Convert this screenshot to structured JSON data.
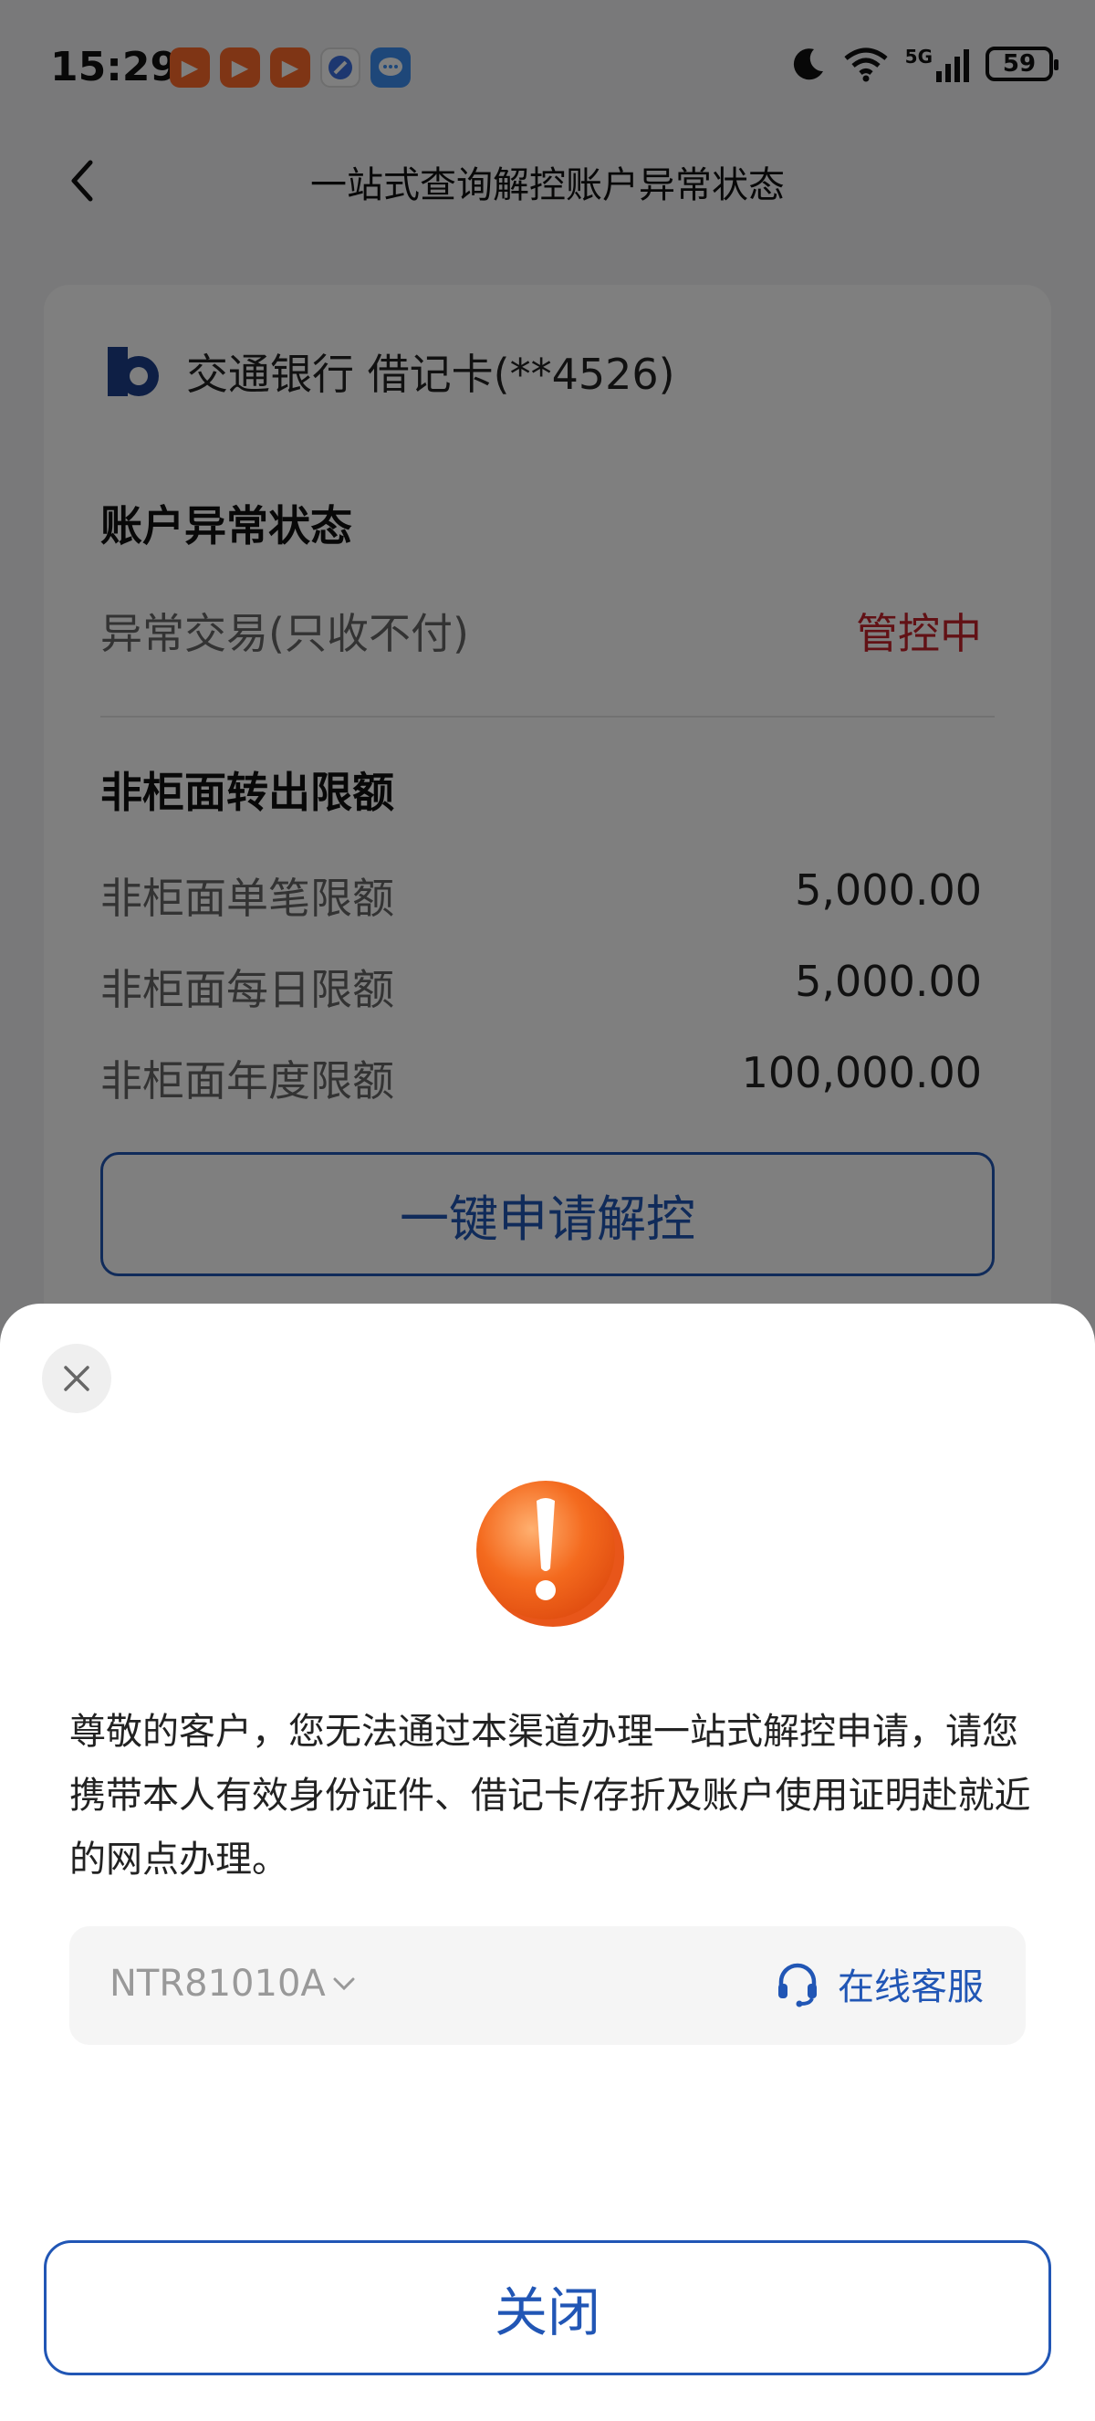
{
  "status_bar": {
    "time": "15:29",
    "battery": "59",
    "network": "5G"
  },
  "header": {
    "title": "一站式查询解控账户异常状态"
  },
  "account": {
    "bank_name": "交通银行 借记卡(**4526)",
    "abnormal_section_title": "账户异常状态",
    "abnormal_label": "异常交易(只收不付)",
    "abnormal_status": "管控中",
    "limit_section_title": "非柜面转出限额",
    "limits": [
      {
        "label": "非柜面单笔限额",
        "value": "5,000.00"
      },
      {
        "label": "非柜面每日限额",
        "value": "5,000.00"
      },
      {
        "label": "非柜面年度限额",
        "value": "100,000.00"
      }
    ],
    "unlock_button": "一键申请解控"
  },
  "dialog": {
    "message": "尊敬的客户，您无法通过本渠道办理一站式解控申请，请您携带本人有效身份证件、借记卡/存折及账户使用证明赴就近的网点办理。",
    "code": "NTR81010A",
    "service_label": "在线客服",
    "close_button": "关闭"
  },
  "colors": {
    "accent": "#2156b5",
    "danger": "#c4232a",
    "warning_orange": "#f46a1e"
  },
  "icons": [
    "back-arrow-icon",
    "bank-logo-icon",
    "close-icon",
    "warning-icon",
    "chevron-down-icon",
    "headset-icon",
    "moon-icon",
    "wifi-icon",
    "signal-icon",
    "battery-icon"
  ]
}
